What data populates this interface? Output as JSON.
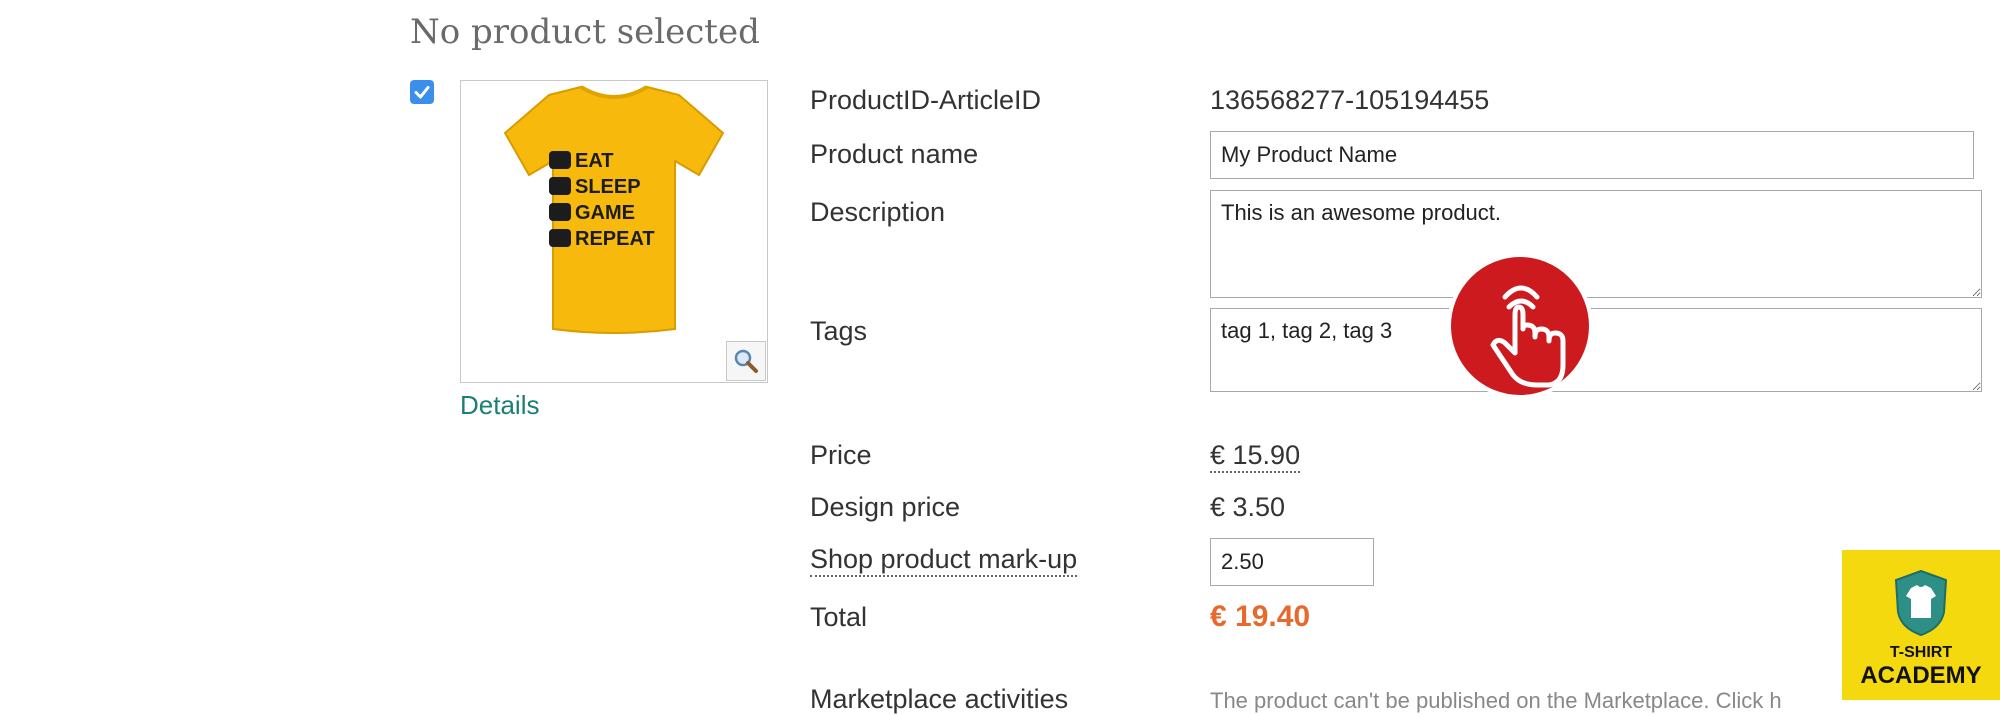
{
  "page": {
    "title": "No product selected"
  },
  "product": {
    "checked": true,
    "image_icon": "t-shirt-eat-sleep-game-repeat",
    "shirt_lines": [
      "EAT",
      "SLEEP",
      "GAME",
      "REPEAT"
    ],
    "shirt_color": "#f6b90c",
    "zoom_icon": "magnifier-icon",
    "details_label": "Details"
  },
  "form": {
    "id_label": "ProductID-ArticleID",
    "id_value": "136568277-105194455",
    "name_label": "Product name",
    "name_value": "My Product Name",
    "description_label": "Description",
    "description_value": "This is an awesome product.",
    "tags_label": "Tags",
    "tags_value": "tag 1, tag 2, tag 3",
    "price_label": "Price",
    "price_value": "€ 15.90",
    "design_price_label": "Design price",
    "design_price_value": "€ 3.50",
    "markup_label": "Shop product mark-up",
    "markup_value": "2.50",
    "total_label": "Total",
    "total_value": "€ 19.40",
    "marketplace_label": "Marketplace activities",
    "marketplace_text": "The product can't be published on the Marketplace. Click h"
  },
  "overlay": {
    "hand_icon": "tap-hand-icon",
    "hand_color": "#cc1a1f"
  },
  "brand": {
    "logo_icon": "shirt-shield-icon",
    "line1": "T-SHIRT",
    "line2": "ACADEMY",
    "bg_color": "#f5d90f"
  },
  "colors": {
    "accent_link": "#1a7f74",
    "total": "#e8692d",
    "checkbox": "#3b8eea"
  }
}
